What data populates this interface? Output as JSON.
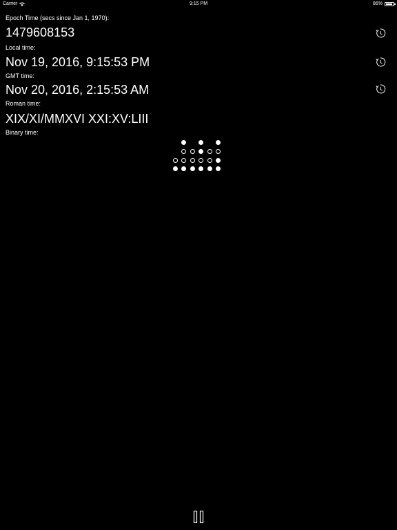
{
  "status_bar": {
    "carrier": "Carrier",
    "time": "9:15 PM",
    "battery": "86%",
    "battery_level": 0.86
  },
  "epoch": {
    "label": "Epoch Time (secs since Jan 1, 1970):",
    "value": "1479608153"
  },
  "local": {
    "label": "Local time:",
    "value": "Nov 19, 2016, 9:15:53 PM"
  },
  "gmt": {
    "label": "GMT time:",
    "value": "Nov 20, 2016, 2:15:53 AM"
  },
  "roman": {
    "label": "Roman time:",
    "value": "XIX/XI/MMXVI XXI:XV:LIII"
  },
  "binary": {
    "label": "Binary time:",
    "columns": [
      [
        null,
        null,
        0,
        1
      ],
      [
        1,
        0,
        0,
        1
      ],
      [
        null,
        0,
        0,
        1
      ],
      [
        1,
        1,
        0,
        1
      ],
      [
        null,
        0,
        0,
        1
      ],
      [
        1,
        0,
        1,
        1
      ]
    ]
  },
  "icons": {
    "clock": "clock-icon",
    "pause": "pause-icon"
  }
}
